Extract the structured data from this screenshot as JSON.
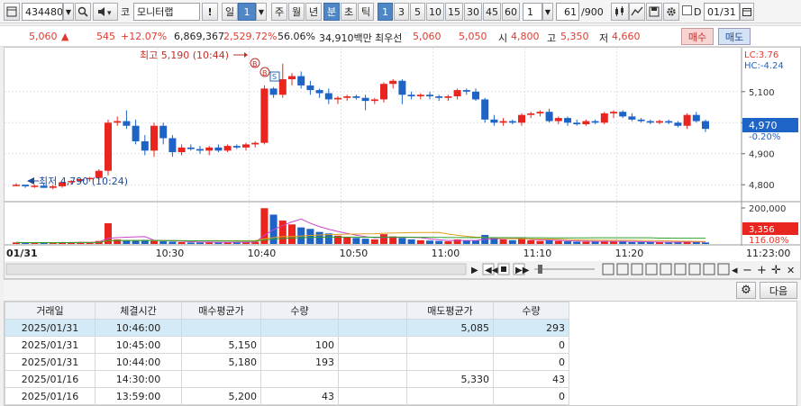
{
  "toolbar": {
    "code": "434480",
    "market_prefix": "코",
    "name": "모니터랩",
    "bang": "!",
    "period_day": "일",
    "period_day_count": "1",
    "periods": [
      "주",
      "월",
      "년",
      "분",
      "초",
      "틱"
    ],
    "minute_buttons": [
      "1",
      "3",
      "5",
      "10",
      "15",
      "30",
      "45",
      "60"
    ],
    "interval_value": "1",
    "page_value": "61",
    "page_total": "/900",
    "d_label": "D",
    "date_value": "01/31"
  },
  "quote": {
    "price": "5,060",
    "arrow": "▲",
    "change": "545",
    "change_pct": "+12.07%",
    "volume": "6,869,367",
    "volume_ratio": "2,529.72%",
    "turnover_pct": "56.06%",
    "amount": "34,910백만",
    "best_label": "최우선",
    "best_ask": "5,060",
    "best_bid": "5,050",
    "open_label": "시",
    "open": "4,800",
    "high_label": "고",
    "high": "5,350",
    "low_label": "저",
    "low": "4,660",
    "buy_label": "매수",
    "sell_label": "매도"
  },
  "chart": {
    "lc": "LC:3.76",
    "hc": "HC:-4.24",
    "high_annotation": "최고 5,190 (10:44)",
    "low_annotation": "최저 4,790 (10:24)",
    "marker_b": "B",
    "marker_s": "S",
    "price_ticks": [
      "5,100",
      "5,000",
      "4,900",
      "4,800"
    ],
    "current_price": "4,970",
    "current_pct": "-0.20%",
    "volume_ticks": [
      "200,000"
    ],
    "current_volume": "3,356",
    "current_volume_pct": "116.08%",
    "date_label": "01/31",
    "time_ticks": [
      "10:30",
      "10:40",
      "10:50",
      "11:00",
      "11:10",
      "11:20",
      "11:23:00"
    ],
    "colors": {
      "up": "#e8251f",
      "down": "#1e63c6",
      "ma1": "#cc44cc",
      "ma2": "#e0a020",
      "ma3": "#2ca02c"
    }
  },
  "chart_data": {
    "type": "candlestick",
    "x_start": "10:22",
    "x_end": "11:23",
    "ylim": [
      4760,
      5230
    ],
    "candles": [
      [
        4800,
        4805,
        4795,
        4800
      ],
      [
        4800,
        4800,
        4790,
        4795
      ],
      [
        4795,
        4800,
        4790,
        4797
      ],
      [
        4797,
        4805,
        4790,
        4790
      ],
      [
        4790,
        4800,
        4785,
        4795
      ],
      [
        4795,
        4810,
        4790,
        4808
      ],
      [
        4808,
        4815,
        4800,
        4812
      ],
      [
        4812,
        4820,
        4805,
        4818
      ],
      [
        4818,
        4825,
        4810,
        4822
      ],
      [
        4822,
        4850,
        4815,
        4845
      ],
      [
        4845,
        5010,
        4830,
        5000
      ],
      [
        5000,
        5020,
        4990,
        5005
      ],
      [
        5005,
        5040,
        4980,
        4990
      ],
      [
        4990,
        5010,
        4930,
        4940
      ],
      [
        4940,
        4960,
        4895,
        4910
      ],
      [
        4910,
        5000,
        4890,
        4990
      ],
      [
        4990,
        5000,
        4930,
        4950
      ],
      [
        4950,
        4960,
        4890,
        4905
      ],
      [
        4905,
        4930,
        4895,
        4920
      ],
      [
        4920,
        4930,
        4910,
        4915
      ],
      [
        4915,
        4925,
        4900,
        4910
      ],
      [
        4910,
        4925,
        4895,
        4920
      ],
      [
        4920,
        4930,
        4905,
        4910
      ],
      [
        4910,
        4930,
        4905,
        4925
      ],
      [
        4925,
        4930,
        4915,
        4920
      ],
      [
        4920,
        4935,
        4910,
        4930
      ],
      [
        4930,
        4940,
        4920,
        4935
      ],
      [
        4935,
        5120,
        4930,
        5110
      ],
      [
        5110,
        5115,
        5080,
        5090
      ],
      [
        5090,
        5190,
        5080,
        5140
      ],
      [
        5140,
        5160,
        5120,
        5150
      ],
      [
        5150,
        5165,
        5110,
        5120
      ],
      [
        5120,
        5135,
        5090,
        5105
      ],
      [
        5105,
        5110,
        5080,
        5095
      ],
      [
        5095,
        5110,
        5060,
        5075
      ],
      [
        5075,
        5085,
        5060,
        5080
      ],
      [
        5080,
        5090,
        5070,
        5085
      ],
      [
        5085,
        5090,
        5075,
        5080
      ],
      [
        5080,
        5090,
        5040,
        5070
      ],
      [
        5070,
        5080,
        5060,
        5075
      ],
      [
        5075,
        5130,
        5065,
        5125
      ],
      [
        5125,
        5140,
        5110,
        5135
      ],
      [
        5135,
        5140,
        5060,
        5090
      ],
      [
        5090,
        5100,
        5075,
        5085
      ],
      [
        5085,
        5095,
        5075,
        5090
      ],
      [
        5090,
        5100,
        5075,
        5085
      ],
      [
        5085,
        5090,
        5070,
        5080
      ],
      [
        5080,
        5090,
        5070,
        5085
      ],
      [
        5085,
        5110,
        5075,
        5105
      ],
      [
        5105,
        5110,
        5090,
        5100
      ],
      [
        5100,
        5110,
        5070,
        5075
      ],
      [
        5075,
        5080,
        5000,
        5010
      ],
      [
        5010,
        5025,
        4990,
        5000
      ],
      [
        5000,
        5015,
        4990,
        5005
      ],
      [
        5005,
        5010,
        4995,
        5000
      ],
      [
        5000,
        5030,
        4990,
        5025
      ],
      [
        5025,
        5035,
        5015,
        5030
      ],
      [
        5030,
        5040,
        5020,
        5035
      ],
      [
        5035,
        5045,
        5000,
        5005
      ],
      [
        5005,
        5020,
        4995,
        5015
      ],
      [
        5015,
        5020,
        4990,
        5000
      ],
      [
        5000,
        5010,
        4990,
        4995
      ],
      [
        4995,
        5010,
        4990,
        5005
      ],
      [
        5005,
        5010,
        4995,
        5000
      ],
      [
        5000,
        5035,
        4995,
        5030
      ],
      [
        5030,
        5040,
        5015,
        5035
      ],
      [
        5035,
        5040,
        5015,
        5020
      ],
      [
        5020,
        5030,
        5005,
        5010
      ],
      [
        5010,
        5015,
        5000,
        5005
      ],
      [
        5005,
        5010,
        4995,
        5000
      ],
      [
        5000,
        5010,
        4995,
        5005
      ],
      [
        5005,
        5010,
        4995,
        5000
      ],
      [
        5000,
        5005,
        4985,
        4990
      ],
      [
        4990,
        5030,
        4980,
        5025
      ],
      [
        5025,
        5035,
        5000,
        5005
      ],
      [
        5005,
        5010,
        4970,
        4980
      ]
    ],
    "volumes": [
      4,
      3,
      3,
      4,
      3,
      5,
      4,
      5,
      4,
      8,
      55,
      12,
      10,
      9,
      11,
      8,
      7,
      6,
      5,
      4,
      4,
      5,
      4,
      4,
      5,
      5,
      6,
      95,
      78,
      62,
      52,
      44,
      40,
      32,
      28,
      22,
      18,
      16,
      14,
      12,
      26,
      20,
      16,
      12,
      10,
      9,
      8,
      7,
      12,
      10,
      9,
      24,
      16,
      12,
      10,
      14,
      10,
      8,
      10,
      8,
      7,
      6,
      6,
      7,
      8,
      7,
      6,
      5,
      5,
      5,
      5,
      4,
      5,
      8,
      6,
      4
    ],
    "volume_ylim": [
      0,
      230000
    ]
  },
  "nav": {
    "settings_label": "⚙",
    "next_label": "다음"
  },
  "table": {
    "headers": [
      "거래일",
      "체결시간",
      "매수평균가",
      "수량",
      "",
      "매도평균가",
      "수량"
    ],
    "rows": [
      [
        "2025/01/31",
        "10:46:00",
        "",
        "",
        "",
        "5,085",
        "293"
      ],
      [
        "2025/01/31",
        "10:45:00",
        "5,150",
        "100",
        "",
        "",
        "0"
      ],
      [
        "2025/01/31",
        "10:44:00",
        "5,180",
        "193",
        "",
        "",
        "0"
      ],
      [
        "2025/01/16",
        "14:30:00",
        "",
        "",
        "",
        "5,330",
        "43"
      ],
      [
        "2025/01/16",
        "13:59:00",
        "5,200",
        "43",
        "",
        "",
        "0"
      ]
    ]
  }
}
